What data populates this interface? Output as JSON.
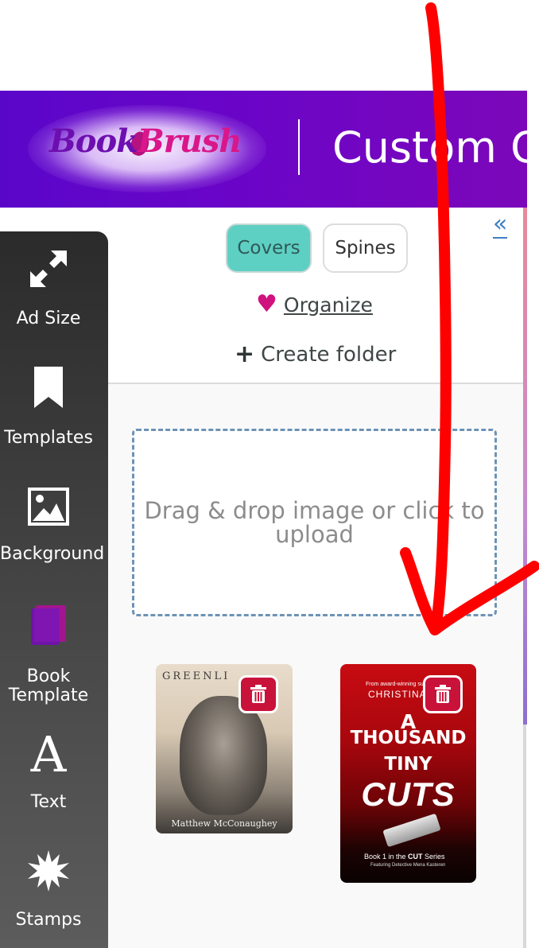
{
  "header": {
    "logo_text_book": "Book",
    "logo_text_brush": "Brush",
    "title": "Custom Cr"
  },
  "sidebar": {
    "items": [
      {
        "label": "Ad Size",
        "icon": "expand-arrows-icon"
      },
      {
        "label": "Templates",
        "icon": "bookmark-icon"
      },
      {
        "label": "Background",
        "icon": "image-icon"
      },
      {
        "label": "Book Template",
        "icon": "book-icon",
        "active": true
      },
      {
        "label": "Text",
        "icon": "text-a-icon"
      },
      {
        "label": "Stamps",
        "icon": "starburst-icon"
      }
    ]
  },
  "panel": {
    "collapse_icon": "double-chevron-left-icon",
    "tabs": [
      {
        "label": "Covers",
        "selected": true
      },
      {
        "label": "Spines",
        "selected": false
      }
    ],
    "organize_label": "Organize",
    "create_folder_label": "Create folder",
    "dropzone_text": "Drag & drop image or click to upload"
  },
  "covers": [
    {
      "title_visible": "GREENLI",
      "author": "Matthew McConaughey"
    },
    {
      "tagline": "From award-winning sus",
      "author": "CHRISTINA",
      "title_line1": "A",
      "title_line2": "THOUSAND",
      "title_line3": "TINY",
      "title_line4": "CUTS",
      "series_prefix": "Book 1 in the ",
      "series_name": "CUT",
      "series_suffix": " Series",
      "featuring": "Featuring Detective Mena Kasteren"
    }
  ],
  "colors": {
    "header_purple": "#6a05c8",
    "covers_tab_teal": "#5ecfc3",
    "delete_red": "#c9123a",
    "annotation_red": "#ff0000",
    "heart_magenta": "#d0127e"
  }
}
